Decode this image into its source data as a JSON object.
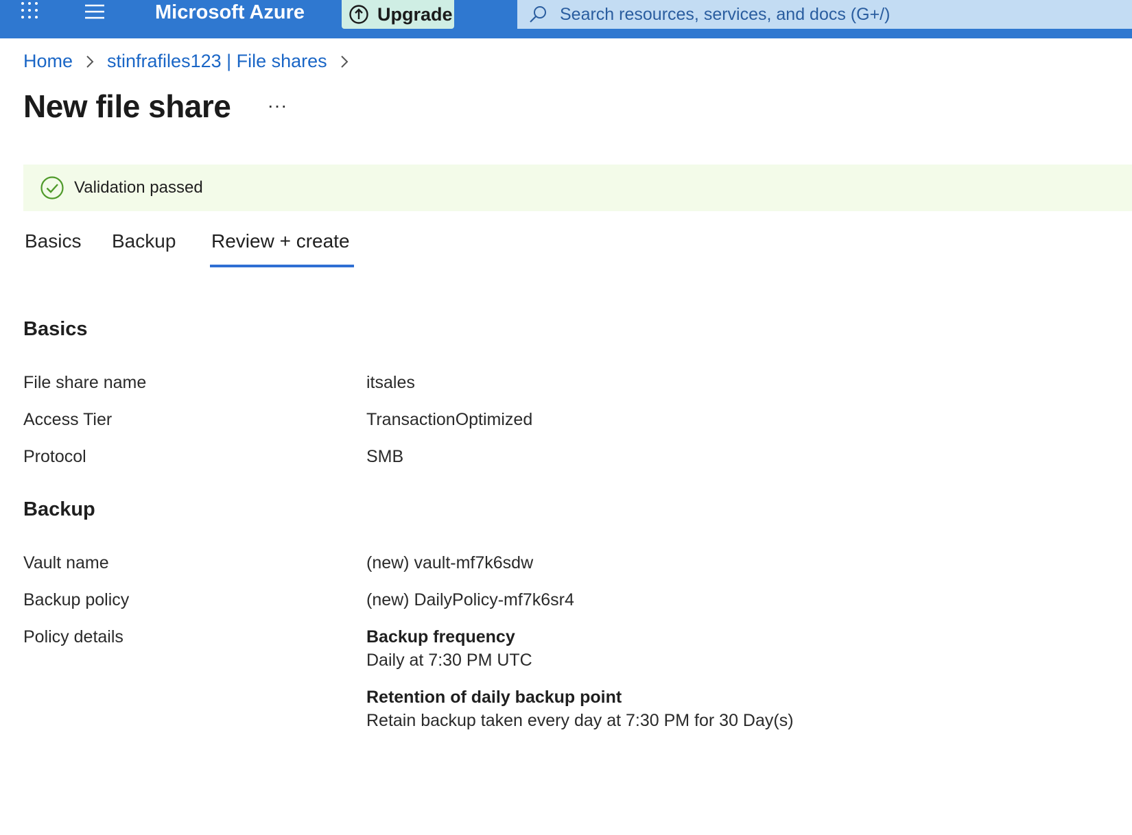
{
  "topbar": {
    "brand": "Microsoft Azure",
    "upgrade_label": "Upgrade",
    "search_placeholder": "Search resources, services, and docs (G+/)"
  },
  "breadcrumb": {
    "items": [
      "Home",
      "stinfrafiles123 | File shares"
    ]
  },
  "page": {
    "title": "New file share",
    "more_label": "..."
  },
  "validation": {
    "text": "Validation passed"
  },
  "tabs": [
    {
      "label": "Basics"
    },
    {
      "label": "Backup"
    },
    {
      "label": "Review + create"
    }
  ],
  "basics": {
    "heading": "Basics",
    "rows": [
      {
        "label": "File share name",
        "value": "itsales"
      },
      {
        "label": "Access Tier",
        "value": "TransactionOptimized"
      },
      {
        "label": "Protocol",
        "value": "SMB"
      }
    ]
  },
  "backup": {
    "heading": "Backup",
    "rows": [
      {
        "label": "Vault name",
        "value": "(new) vault-mf7k6sdw"
      },
      {
        "label": "Backup policy",
        "value": "(new) DailyPolicy-mf7k6sr4"
      }
    ],
    "policy_details_label": "Policy details",
    "frequency_heading": "Backup frequency",
    "frequency_value": "Daily at 7:30 PM UTC",
    "retention_heading": "Retention of daily backup point",
    "retention_value": "Retain backup taken every day at 7:30 PM for 30 Day(s)"
  },
  "colors": {
    "header_blue": "#2f78d0",
    "link_blue": "#1a66c6",
    "success_green": "#4f9a2a",
    "banner_bg": "#f3fbe9",
    "tab_underline": "#2f6fd3"
  }
}
